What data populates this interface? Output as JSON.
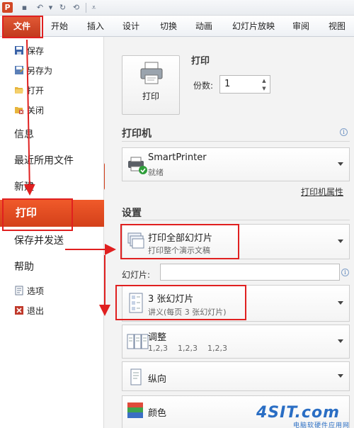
{
  "titlebar": {
    "app_icon": "P",
    "quick_access": [
      "save-icon",
      "undo-icon",
      "redo-icon",
      "repeat-icon",
      "customize-icon"
    ]
  },
  "tabs": [
    "文件",
    "开始",
    "插入",
    "设计",
    "切换",
    "动画",
    "幻灯片放映",
    "审阅",
    "视图"
  ],
  "nav": {
    "save": "保存",
    "save_as": "另存为",
    "open": "打开",
    "close": "关闭",
    "info": "信息",
    "recent": "最近所用文件",
    "new": "新建",
    "print": "打印",
    "save_send": "保存并发送",
    "help": "帮助",
    "options": "选项",
    "exit": "退出"
  },
  "print": {
    "section_title": "打印",
    "print_button": "打印",
    "copies_label": "份数:",
    "copies_value": "1"
  },
  "printer": {
    "section_title": "打印机",
    "name": "SmartPrinter",
    "status": "就绪",
    "properties_link": "打印机属性"
  },
  "settings": {
    "section_title": "设置",
    "range": {
      "title": "打印全部幻灯片",
      "subtitle": "打印整个演示文稿"
    },
    "slides_label": "幻灯片:",
    "layout": {
      "title": "3 张幻灯片",
      "subtitle": "讲义(每页 3 张幻灯片)"
    },
    "collate": {
      "title": "调整",
      "subtitle": "1,2,3    1,2,3    1,2,3"
    },
    "orientation": {
      "title": "纵向"
    },
    "color": {
      "title": "颜色"
    }
  },
  "watermark": {
    "logo": "4SIT.com",
    "subtitle": "电脑软硬件应用网"
  },
  "colors": {
    "accent": "#d3401a",
    "annotation": "#e02020"
  }
}
